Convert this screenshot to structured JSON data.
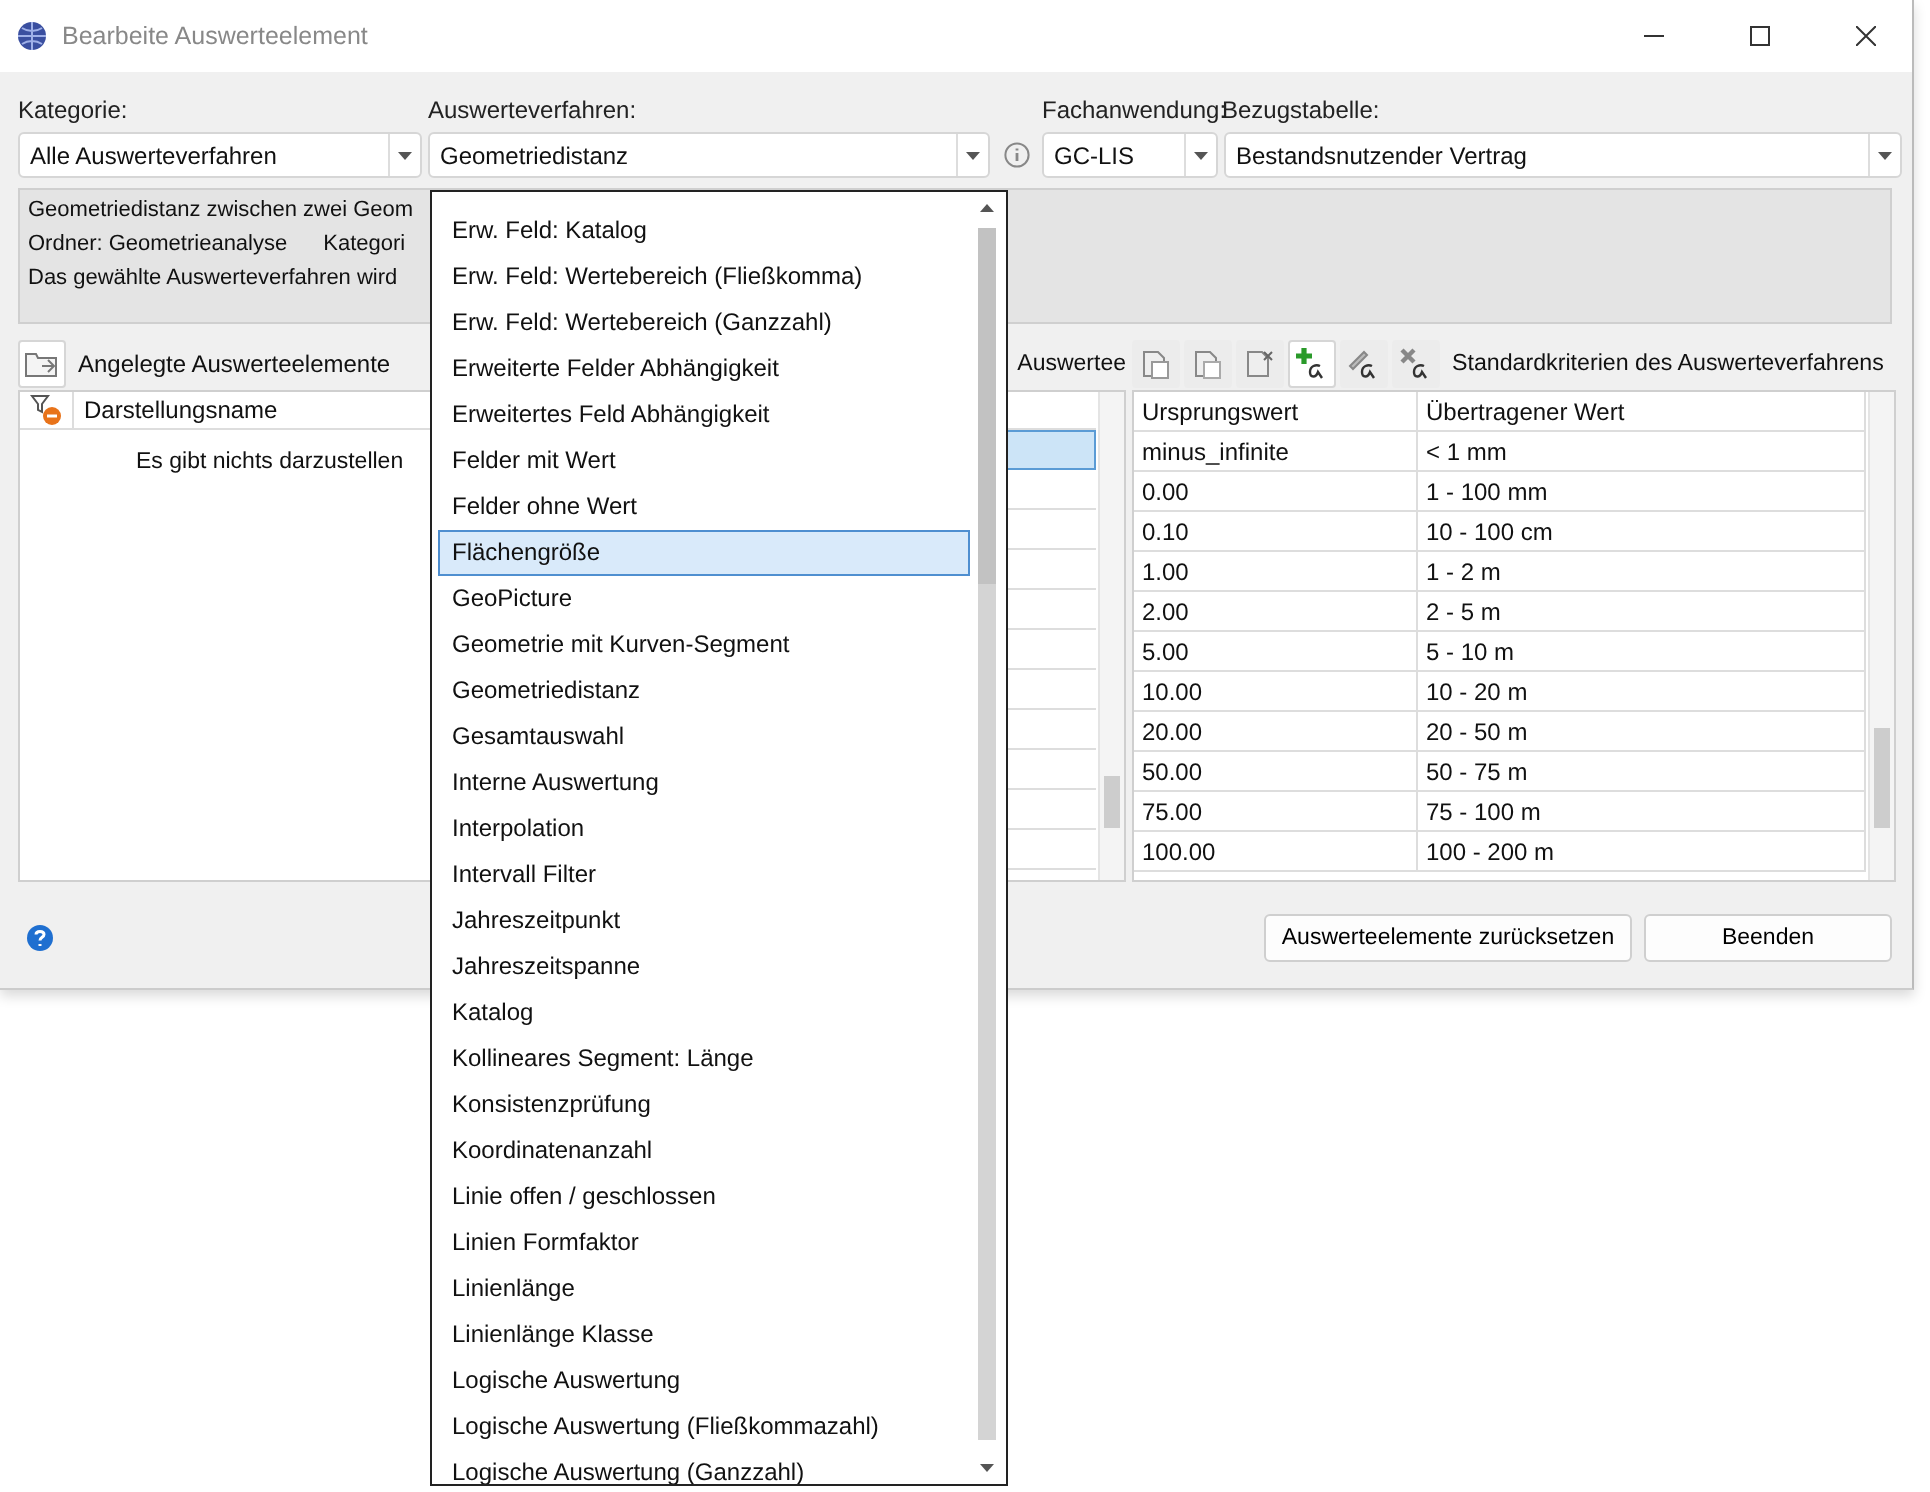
{
  "window": {
    "title": "Bearbeite Auswerteelement"
  },
  "fields": {
    "kategorie_label": "Kategorie:",
    "kategorie_value": "Alle Auswerteverfahren",
    "verfahren_label": "Auswerteverfahren:",
    "verfahren_value": "Geometriedistanz",
    "fachanwendung_label": "Fachanwendung:",
    "fachanwendung_value": "GC-LIS",
    "bezugstabelle_label": "Bezugstabelle:",
    "bezugstabelle_value": "Bestandsnutzender Vertrag"
  },
  "description": {
    "line_1": "Geometriedistanz zwischen zwei Geom",
    "line_2_folder": "Ordner: Geometrieanalyse",
    "line_2_category": "Kategori",
    "line_3": "Das gewählte Auswerteverfahren wird"
  },
  "left_panel": {
    "title": "Angelegte Auswerteelemente",
    "column": "Darstellungsname",
    "empty_text": "Es gibt nichts darzustellen"
  },
  "middle_panel": {
    "title": "Auswertee",
    "rows": [
      {
        "selected": true
      },
      {
        "selected": false
      },
      {
        "selected": false
      },
      {
        "selected": false
      },
      {
        "selected": false
      },
      {
        "selected": false
      },
      {
        "selected": false
      },
      {
        "selected": false
      },
      {
        "selected": false
      },
      {
        "selected": false
      },
      {
        "selected": false
      }
    ]
  },
  "right_panel": {
    "title": "Standardkriterien des Auswerteverfahrens",
    "columns": [
      "Ursprungswert",
      "Übertragener Wert"
    ],
    "rows": [
      [
        "minus_infinite",
        "< 1 mm"
      ],
      [
        "0.00",
        "1 - 100 mm"
      ],
      [
        "0.10",
        "10 - 100 cm"
      ],
      [
        "1.00",
        "1 - 2 m"
      ],
      [
        "2.00",
        "2 - 5 m"
      ],
      [
        "5.00",
        "5 - 10 m"
      ],
      [
        "10.00",
        "10 - 20 m"
      ],
      [
        "20.00",
        "20 - 50 m"
      ],
      [
        "50.00",
        "50 - 75 m"
      ],
      [
        "75.00",
        "75 - 100 m"
      ],
      [
        "100.00",
        "100 - 200 m"
      ]
    ]
  },
  "buttons": [
    "Auswerteelemente zurücksetzen",
    "Beenden"
  ],
  "dropdown": {
    "items": [
      {
        "label": "Erw. Feld: Katalog",
        "selected": false
      },
      {
        "label": "Erw. Feld: Wertebereich (Fließkomma)",
        "selected": false
      },
      {
        "label": "Erw. Feld: Wertebereich (Ganzzahl)",
        "selected": false
      },
      {
        "label": "Erweiterte Felder Abhängigkeit",
        "selected": false
      },
      {
        "label": "Erweitertes Feld Abhängigkeit",
        "selected": false
      },
      {
        "label": "Felder mit Wert",
        "selected": false
      },
      {
        "label": "Felder ohne Wert",
        "selected": false
      },
      {
        "label": "Flächengröße",
        "selected": true
      },
      {
        "label": "GeoPicture",
        "selected": false
      },
      {
        "label": "Geometrie mit Kurven-Segment",
        "selected": false
      },
      {
        "label": "Geometriedistanz",
        "selected": false
      },
      {
        "label": "Gesamtauswahl",
        "selected": false
      },
      {
        "label": "Interne Auswertung",
        "selected": false
      },
      {
        "label": "Interpolation",
        "selected": false
      },
      {
        "label": "Intervall Filter",
        "selected": false
      },
      {
        "label": "Jahreszeitpunkt",
        "selected": false
      },
      {
        "label": "Jahreszeitspanne",
        "selected": false
      },
      {
        "label": "Katalog",
        "selected": false
      },
      {
        "label": "Kollineares Segment: Länge",
        "selected": false
      },
      {
        "label": "Konsistenzprüfung",
        "selected": false
      },
      {
        "label": "Koordinatenanzahl",
        "selected": false
      },
      {
        "label": "Linie offen / geschlossen",
        "selected": false
      },
      {
        "label": "Linien Formfaktor",
        "selected": false
      },
      {
        "label": "Linienlänge",
        "selected": false
      },
      {
        "label": "Linienlänge Klasse",
        "selected": false
      },
      {
        "label": "Logische Auswertung",
        "selected": false
      },
      {
        "label": "Logische Auswertung (Fließkommazahl)",
        "selected": false
      },
      {
        "label": "Logische Auswertung (Ganzzahl)",
        "selected": false
      }
    ]
  }
}
